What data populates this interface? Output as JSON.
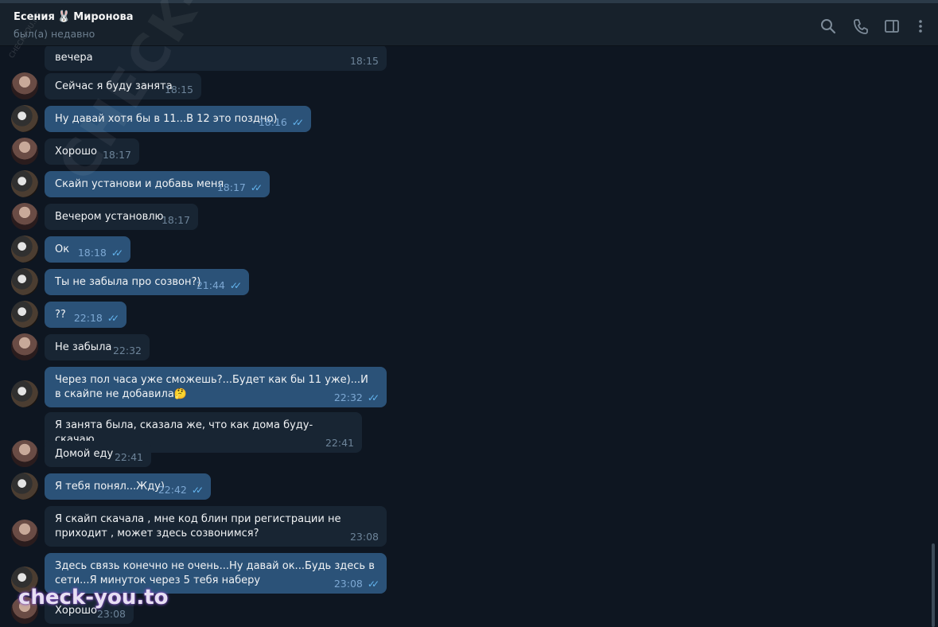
{
  "header": {
    "name_first": "Есения",
    "name_emoji": "🐰",
    "name_last": "Миронова",
    "status": "был(а) недавно",
    "icons": [
      "search-icon",
      "phone-icon",
      "sidebar-icon",
      "more-icon"
    ]
  },
  "messages": [
    {
      "text": "вечера",
      "time": "18:15",
      "dir": "in"
    },
    {
      "text": "Сейчас я буду занята",
      "time": "18:15",
      "dir": "in"
    },
    {
      "text": "Ну давай хотя бы в 11...В 12 это поздно)",
      "time": "18:16",
      "dir": "out"
    },
    {
      "text": "Хорошо",
      "time": "18:17",
      "dir": "in"
    },
    {
      "text": "Скайп установи и добавь меня",
      "time": "18:17",
      "dir": "out"
    },
    {
      "text": "Вечером установлю",
      "time": "18:17",
      "dir": "in"
    },
    {
      "text": "Ок",
      "time": "18:18",
      "dir": "out"
    },
    {
      "text": "Ты не забыла про созвон?)",
      "time": "21:44",
      "dir": "out"
    },
    {
      "text": "??",
      "time": "22:18",
      "dir": "out"
    },
    {
      "text": "Не забыла",
      "time": "22:32",
      "dir": "in"
    },
    {
      "text": "Через пол часа уже сможешь?...Будет как бы 11 уже)...И в скайпе не добавила🤔",
      "time": "22:32",
      "dir": "out"
    },
    {
      "text": "Я занята была, сказала же, что как дома буду- скачаю",
      "time": "22:41",
      "dir": "in"
    },
    {
      "text": "Домой еду",
      "time": "22:41",
      "dir": "in"
    },
    {
      "text": "Я тебя понял...Жду)",
      "time": "22:42",
      "dir": "out"
    },
    {
      "text": "Я скайп скачала , мне код блин при регистрации не приходит , может здесь созвонимся?",
      "time": "23:08",
      "dir": "in"
    },
    {
      "text": "Здесь связь конечно не очень...Ну давай ок...Будь здесь в сети...Я минуток через 5 тебя наберу",
      "time": "23:08",
      "dir": "out"
    },
    {
      "text": "Хорошо",
      "time": "23:08",
      "dir": "in"
    }
  ],
  "ticks": "✓✓",
  "watermarks": {
    "diagonal": "CHECK-YOU.ME",
    "small": "CHECK-YOU.ME",
    "bottom": "check-you.to"
  },
  "colors": {
    "bg": "#0e1621",
    "header": "#17212b",
    "incoming": "#182533",
    "outgoing": "#2b5278",
    "tick": "#64b5ef"
  }
}
